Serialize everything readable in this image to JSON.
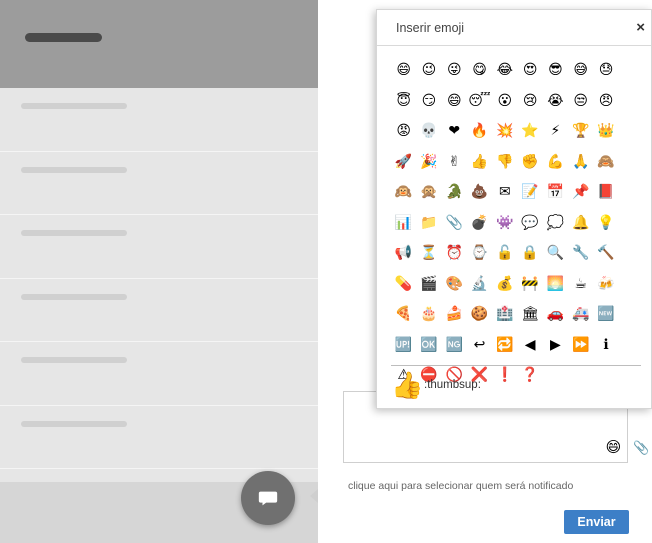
{
  "popup": {
    "title": "Inserir emoji",
    "close_label": "×",
    "emojis": [
      "😄",
      "😉",
      "😜",
      "😋",
      "😂",
      "😍",
      "😎",
      "😅",
      "😓",
      "😇",
      "😏",
      "😄",
      "😴",
      "😮",
      "😢",
      "😭",
      "😒",
      "😠",
      "😡",
      "💀",
      "❤",
      "🔥",
      "💥",
      "⭐",
      "⚡",
      "🏆",
      "👑",
      "🚀",
      "🎉",
      "✌",
      "👍",
      "👎",
      "✊",
      "💪",
      "🙏",
      "🙈",
      "🙉",
      "🙊",
      "🐊",
      "💩",
      "✉",
      "📝",
      "📅",
      "📌",
      "📕",
      "📊",
      "📁",
      "📎",
      "💣",
      "👾",
      "💬",
      "💭",
      "🔔",
      "💡",
      "📢",
      "⏳",
      "⏰",
      "⌚",
      "🔓",
      "🔒",
      "🔍",
      "🔧",
      "🔨",
      "💊",
      "🎬",
      "🎨",
      "🔬",
      "💰",
      "🚧",
      "🌅",
      "☕",
      "🍻",
      "🍕",
      "🎂",
      "🍰",
      "🍪",
      "🏥",
      "🏛",
      "🚗",
      "🚑",
      "🆕",
      "🆙",
      "🆗",
      "🆖",
      "↩",
      "🔁",
      "◀",
      "▶",
      "⏩",
      "ℹ",
      "⚠",
      "⛔",
      "🚫",
      "❌",
      "❗",
      "❓"
    ],
    "preview": {
      "emoji": "👍",
      "name": ":thumbsup:"
    }
  },
  "composer": {
    "smiley": "😄",
    "attach_icon": "📎"
  },
  "notify_text": "clique aqui para selecionar quem será notificado",
  "send_label": "Enviar",
  "left_rows": 6
}
